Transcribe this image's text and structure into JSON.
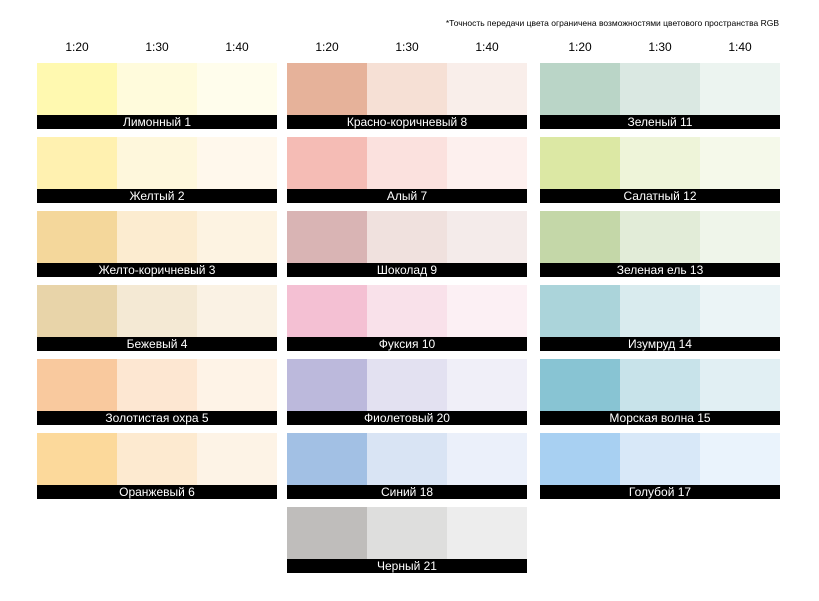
{
  "note": "*Точность передачи цвета ограничена возможностями цветового пространства RGB",
  "ratios": [
    "1:20",
    "1:30",
    "1:40"
  ],
  "columns": [
    {
      "swatches": [
        {
          "name": "Лимонный 1",
          "colors": [
            "#fff9b0",
            "#fffbdc",
            "#fffdec"
          ]
        },
        {
          "name": "Желтый 2",
          "colors": [
            "#fff1b0",
            "#fef7dc",
            "#fff8ec"
          ]
        },
        {
          "name": "Желто-коричневый 3",
          "colors": [
            "#f4d79b",
            "#fcecd0",
            "#fdf3e2"
          ]
        },
        {
          "name": "Бежевый 4",
          "colors": [
            "#e8d4a9",
            "#f4e9d4",
            "#faf2e4"
          ]
        },
        {
          "name": "Золотистая охра 5",
          "colors": [
            "#f9c99e",
            "#fde7d2",
            "#fef3e7"
          ]
        },
        {
          "name": "Оранжевый 6",
          "colors": [
            "#fcd99b",
            "#fdead0",
            "#fdf3e6"
          ]
        }
      ]
    },
    {
      "swatches": [
        {
          "name": "Красно-коричневый 8",
          "colors": [
            "#e6b29a",
            "#f6e0d5",
            "#f9eeea"
          ]
        },
        {
          "name": "Алый 7",
          "colors": [
            "#f5bcb5",
            "#fbe1de",
            "#fdf0ee"
          ]
        },
        {
          "name": "Шоколад 9",
          "colors": [
            "#d9b4b4",
            "#f0e1de",
            "#f4ebea"
          ]
        },
        {
          "name": "Фуксия 10",
          "colors": [
            "#f4c0d3",
            "#f9e1ea",
            "#fcf0f4"
          ]
        },
        {
          "name": "Фиолетовый 20",
          "colors": [
            "#bcb9dc",
            "#e3e1f1",
            "#f0eff8"
          ]
        },
        {
          "name": "Синий 18",
          "colors": [
            "#a2c0e4",
            "#d9e4f4",
            "#ebf0fa"
          ]
        },
        {
          "name": "Черный 21",
          "colors": [
            "#bfbdbb",
            "#dededd",
            "#ededed"
          ]
        }
      ]
    },
    {
      "swatches": [
        {
          "name": "Зеленый 11",
          "colors": [
            "#bad5c7",
            "#dae8e2",
            "#ecf4f0"
          ]
        },
        {
          "name": "Салатный 12",
          "colors": [
            "#dce8a4",
            "#eef4d9",
            "#f5f9ea"
          ]
        },
        {
          "name": "Зеленая ель 13",
          "colors": [
            "#c4d7a8",
            "#e2ecd8",
            "#eff5ea"
          ]
        },
        {
          "name": "Изумруд 14",
          "colors": [
            "#abd4da",
            "#d9ebee",
            "#ebf4f6"
          ]
        },
        {
          "name": "Морская волна 15",
          "colors": [
            "#88c4d3",
            "#c8e3ea",
            "#e1eff3"
          ]
        },
        {
          "name": "Голубой 17",
          "colors": [
            "#a8d0f2",
            "#d8e8f8",
            "#eaf3fc"
          ]
        }
      ]
    }
  ]
}
